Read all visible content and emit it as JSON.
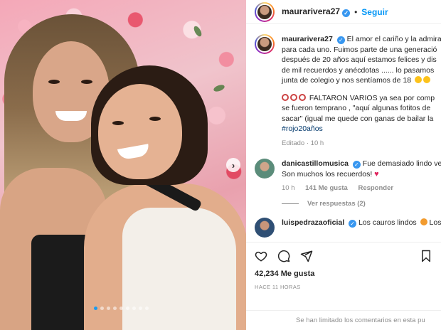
{
  "post": {
    "username": "maurarivera27",
    "follow_label": "Seguir",
    "separator": "•",
    "carousel": {
      "slides": 9,
      "active_index": 0
    },
    "caption": {
      "username": "maurarivera27",
      "lines": [
        "El amor el cariño y la admira",
        "para cada uno. Fuimos parte de una generació",
        "después de 20 años aquí estamos felices y dis",
        "de mil recuerdos y anécdotas ...... lo pasamos",
        "junta de colegio y nos sentíamos de 18"
      ],
      "lines2": [
        "FALTARON VARIOS ya sea por comp",
        "se fueron temprano , \"aquí algunas fotitos de",
        "sacar\" (igual me quede con ganas de bailar la"
      ],
      "hashtag": "#rojo20años",
      "meta": "Editado · 10 h"
    },
    "comments": [
      {
        "username": "danicastillomusica",
        "text_line1": "Fue demasiado lindo ve",
        "text_line2": "Son muchos los recuerdos!",
        "time": "10 h",
        "likes": "141 Me gusta",
        "reply": "Responder",
        "view_replies": "Ver respuestas (2)"
      },
      {
        "username": "luispedrazaoficial",
        "text": "Los cauros lindos",
        "text_tail": "Los"
      }
    ],
    "likes_total": "42,234 Me gusta",
    "time_ago": "HACE 11 HORAS",
    "comments_disabled": "Se han limitado los comentarios en esta pu"
  }
}
